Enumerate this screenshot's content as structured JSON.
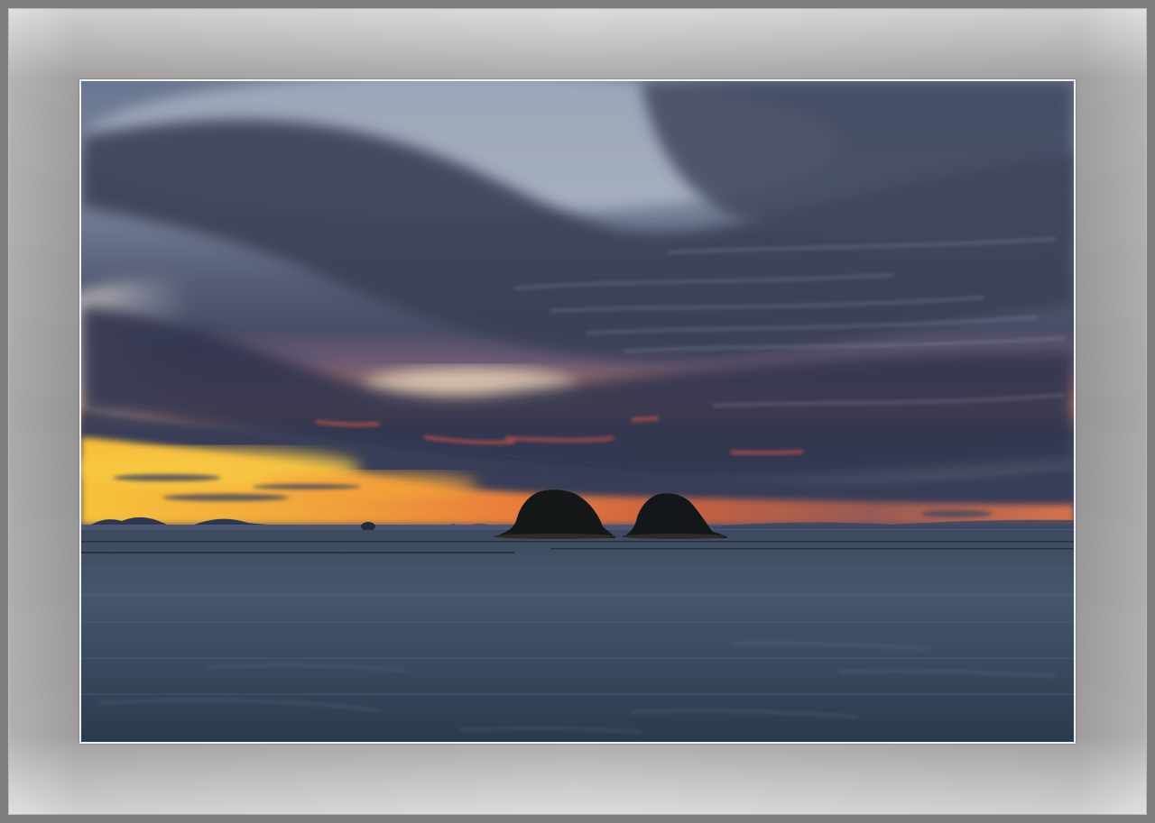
{
  "image": {
    "subject": "sunset-seascape-with-two-islands",
    "colors": {
      "mat": "#9e9e9e",
      "border": "#f0f0f0",
      "sky_top": "#55627d",
      "cloud_dark": "#353b52",
      "sunset_gold": "#f2b23a",
      "sunset_red": "#e0563a",
      "sea": "#3b4a5f",
      "island": "#161a1c"
    }
  }
}
